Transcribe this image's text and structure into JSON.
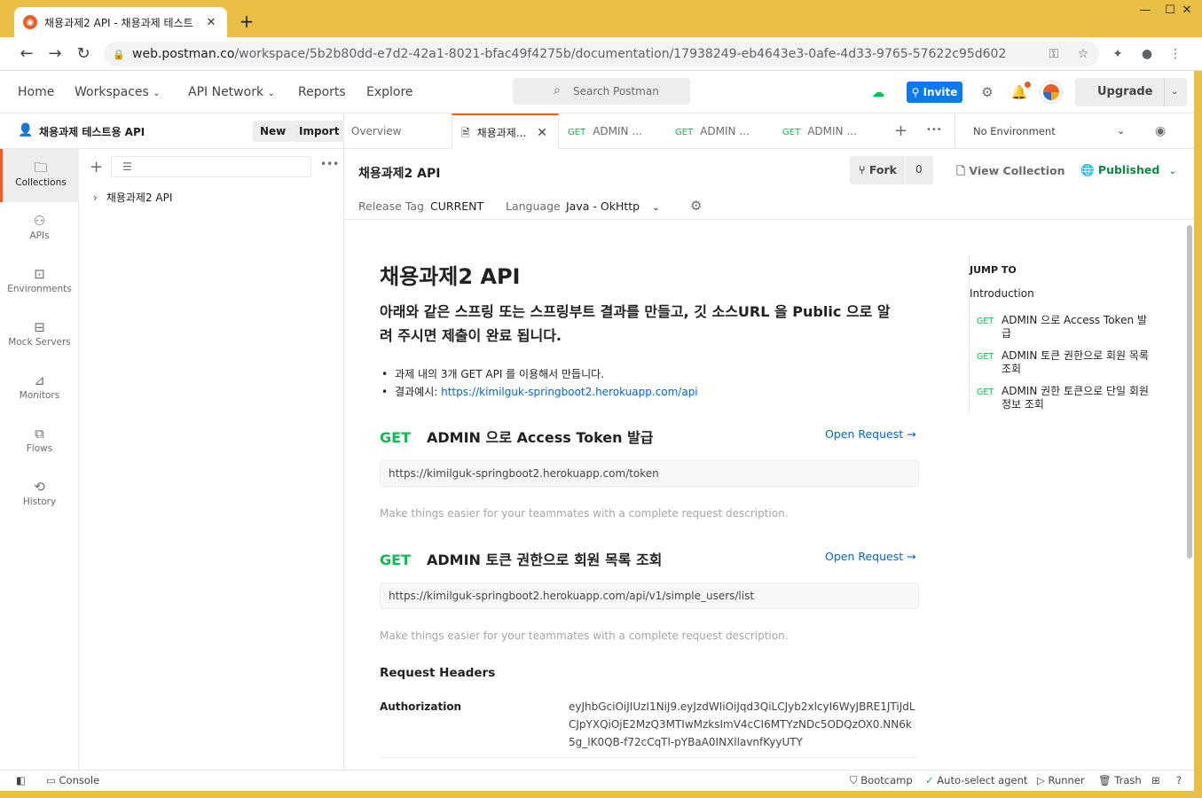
{
  "browser": {
    "tab_title": "채용과제2 API - 채용과제 테스트",
    "tab_close": "✕",
    "new_tab": "+",
    "url_host": "web.postman.co",
    "url_path": "/workspace/5b2b80dd-e7d2-42a1-8021-bfac49f4275b/documentation/17938249-eb4643e3-0afe-4d33-9765-57622c95d602",
    "win_min": "—",
    "win_max": "☐",
    "win_close": "✕"
  },
  "header": {
    "nav": [
      "Home",
      "Workspaces",
      "API Network",
      "Reports",
      "Explore"
    ],
    "search_placeholder": "Search Postman",
    "invite_label": "Invite",
    "upgrade_label": "Upgrade"
  },
  "workspace": {
    "name": "채용과제 테스트용 API",
    "new_label": "New",
    "import_label": "Import"
  },
  "rail": [
    {
      "label": "Collections",
      "icon": "collections-icon",
      "glyph": "🗀"
    },
    {
      "label": "APIs",
      "icon": "apis-icon",
      "glyph": "⚇"
    },
    {
      "label": "Environments",
      "icon": "environments-icon",
      "glyph": "⊡"
    },
    {
      "label": "Mock Servers",
      "icon": "mock-servers-icon",
      "glyph": "⊟"
    },
    {
      "label": "Monitors",
      "icon": "monitors-icon",
      "glyph": "⊿"
    },
    {
      "label": "Flows",
      "icon": "flows-icon",
      "glyph": "⧉"
    },
    {
      "label": "History",
      "icon": "history-icon",
      "glyph": "⟲"
    }
  ],
  "tree": {
    "collection": "채용과제2 API"
  },
  "tabs": {
    "overview": "Overview",
    "active": "채용과제...",
    "t1_method": "GET",
    "t1_label": "ADMIN ...",
    "t2_method": "GET",
    "t2_label": "ADMIN ...",
    "t3_method": "GET",
    "t3_label": "ADMIN ...",
    "environment": "No Environment"
  },
  "doc": {
    "title": "채용과제2 API",
    "fork_label": "Fork",
    "fork_count": "0",
    "view_collection": "View Collection",
    "published": "Published",
    "release_tag_label": "Release Tag",
    "release_tag_value": "CURRENT",
    "language_label": "Language",
    "language_value": "Java - OkHttp",
    "heading": "채용과제2 API",
    "lead": "아래와 같은 스프링 또는 스프링부트 결과를 만들고, 깃 소스URL 을 Public 으로 알려 주시면 제출이 완료 됩니다.",
    "bullet1": "과제 내의 3개 GET API 를 이용해서 만듭니다.",
    "bullet2_prefix": "결과예시: ",
    "bullet2_link": "https://kimilguk-springboot2.herokuapp.com/api",
    "endpoints": [
      {
        "method": "GET",
        "name": "ADMIN 으로 Access Token 발급",
        "open": "Open Request →",
        "url": "https://kimilguk-springboot2.herokuapp.com/token",
        "desc": "Make things easier for your teammates with a complete request description."
      },
      {
        "method": "GET",
        "name": "ADMIN 토큰 권한으로 회원 목록 조회",
        "open": "Open Request →",
        "url": "https://kimilguk-springboot2.herokuapp.com/api/v1/simple_users/list",
        "desc": "Make things easier for your teammates with a complete request description."
      }
    ],
    "request_headers": "Request Headers",
    "auth_key": "Authorization",
    "auth_value": "eyJhbGciOiJIUzI1NiJ9.eyJzdWIiOiJqd3QiLCJyb2xlcyI6WyJBRE1JTiJdLCJpYXQiOjE2MzQ3MTIwMzksImV4cCI6MTYzNDc5ODQzOX0.NN6k5g_lK0QB-f72cCqTl-pYBaA0INXllavnfKyyUTY"
  },
  "jump": {
    "heading": "JUMP TO",
    "intro": "Introduction",
    "items": [
      {
        "method": "GET",
        "label": "ADMIN 으로 Access Token 발급"
      },
      {
        "method": "GET",
        "label": "ADMIN 토큰 권한으로 회원 목록 조회"
      },
      {
        "method": "GET",
        "label": "ADMIN 권한 토큰으로 단일 회원 정보 조회"
      }
    ]
  },
  "status": {
    "console": "Console",
    "bootcamp": "Bootcamp",
    "agent": "Auto-select agent",
    "runner": "Runner",
    "trash": "Trash"
  },
  "colors": {
    "accent": "#ef5b25",
    "get": "#0cbb52",
    "link": "#0265d2",
    "invite": "#097bed",
    "published": "#0a8a43",
    "chrome_frame": "#e9bf45"
  }
}
